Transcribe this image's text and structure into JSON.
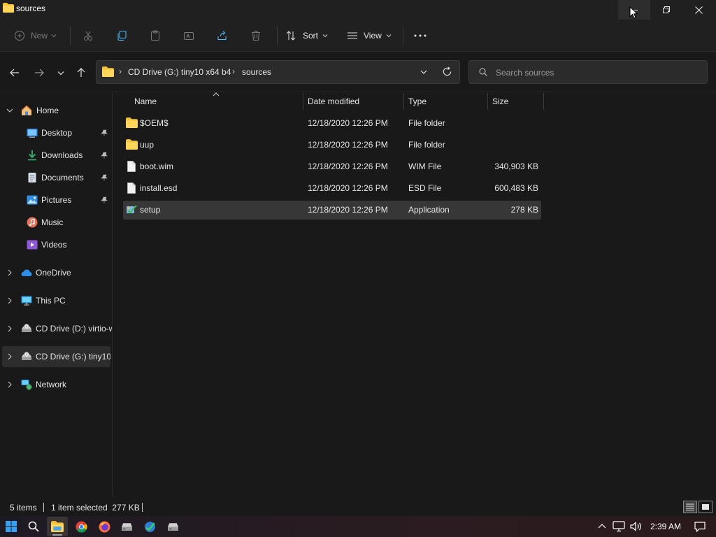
{
  "window": {
    "title": "sources"
  },
  "toolbar": {
    "new_label": "New",
    "sort_label": "Sort",
    "view_label": "View"
  },
  "address": {
    "crumbs": [
      "CD Drive (G:) tiny10 x64 b4",
      "sources"
    ]
  },
  "search": {
    "placeholder": "Search sources"
  },
  "sidebar": {
    "home": "Home",
    "quick": [
      "Desktop",
      "Downloads",
      "Documents",
      "Pictures",
      "Music",
      "Videos"
    ],
    "onedrive": "OneDrive",
    "thispc": "This PC",
    "drive_d": "CD Drive (D:) virtio-w",
    "drive_g": "CD Drive (G:) tiny10 :",
    "network": "Network"
  },
  "columns": {
    "name": "Name",
    "date": "Date modified",
    "type": "Type",
    "size": "Size"
  },
  "files": [
    {
      "name": "$OEM$",
      "date": "12/18/2020 12:26 PM",
      "type": "File folder",
      "size": "",
      "icon": "folder-icon"
    },
    {
      "name": "uup",
      "date": "12/18/2020 12:26 PM",
      "type": "File folder",
      "size": "",
      "icon": "folder-icon"
    },
    {
      "name": "boot.wim",
      "date": "12/18/2020 12:26 PM",
      "type": "WIM File",
      "size": "340,903 KB",
      "icon": "file-icon"
    },
    {
      "name": "install.esd",
      "date": "12/18/2020 12:26 PM",
      "type": "ESD File",
      "size": "600,483 KB",
      "icon": "file-icon"
    },
    {
      "name": "setup",
      "date": "12/18/2020 12:26 PM",
      "type": "Application",
      "size": "278 KB",
      "icon": "setup-icon"
    }
  ],
  "status": {
    "count": "5 items",
    "selected": "1 item selected  277 KB"
  },
  "taskbar": {
    "time": "2:39 AM"
  },
  "colors": {
    "folder": "#f3c33c",
    "accent": "#4cc2ff",
    "selected_row": "#373737"
  }
}
